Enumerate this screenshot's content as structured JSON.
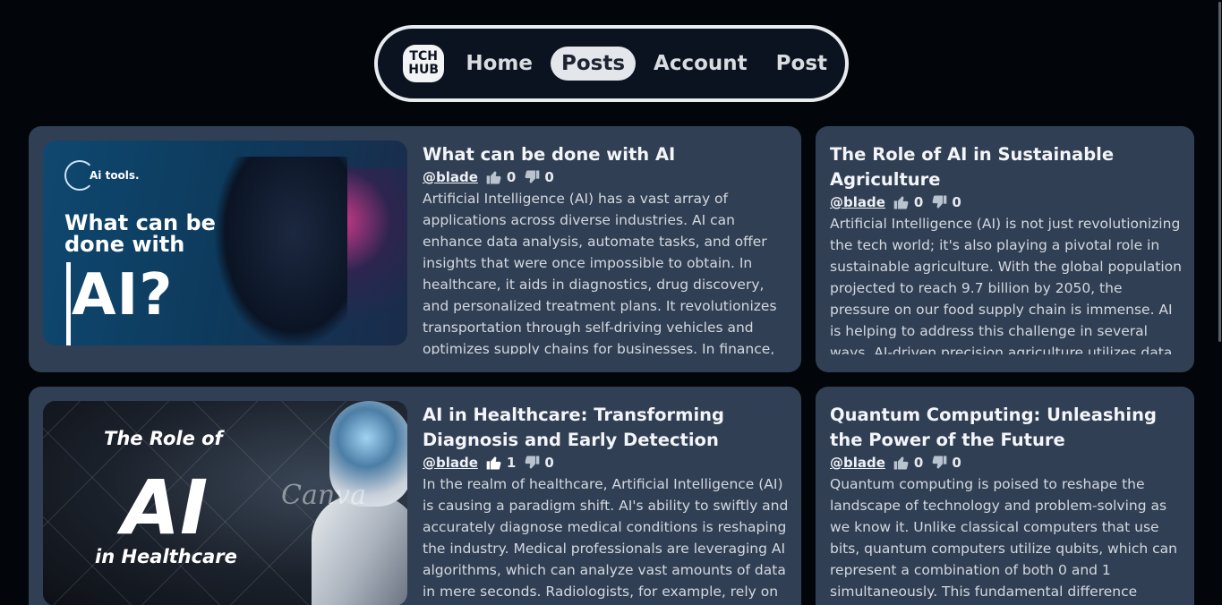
{
  "nav": {
    "logo_line1": "TCH",
    "logo_line2": "HUB",
    "links": [
      "Home",
      "Posts",
      "Account",
      "Post"
    ],
    "active": "Posts"
  },
  "posts": [
    {
      "title": "What can be done with AI",
      "author": "@blade",
      "likes": "0",
      "dislikes": "0",
      "excerpt": "Artificial Intelligence (AI) has a vast array of applications across diverse industries. AI can enhance data analysis, automate tasks, and offer insights that were once impossible to obtain. In healthcare, it aids in diagnostics, drug discovery, and personalized treatment plans. It revolutionizes transportation through self-driving vehicles and optimizes supply chains for businesses. In finance, AI detects",
      "image": {
        "brand": "Ai tools.",
        "heading_line1": "What can be",
        "heading_line2": "done with",
        "big": "AI?"
      }
    },
    {
      "title": "The Role of AI in Sustainable Agriculture",
      "author": "@blade",
      "likes": "0",
      "dislikes": "0",
      "excerpt": "Artificial Intelligence (AI) is not just revolutionizing the tech world; it's also playing a pivotal role in sustainable agriculture. With the global population projected to reach 9.7 billion by 2050, the pressure on our food supply chain is immense. AI is helping to address this challenge in several ways. AI-driven precision agriculture utilizes data from various"
    },
    {
      "title": "AI in Healthcare: Transforming Diagnosis and Early Detection",
      "author": "@blade",
      "likes": "1",
      "dislikes": "0",
      "excerpt": "In the realm of healthcare, Artificial Intelligence (AI) is causing a paradigm shift. AI's ability to swiftly and accurately diagnose medical conditions is reshaping the industry. Medical professionals are leveraging AI algorithms, which can analyze vast amounts of data in mere seconds. Radiologists, for example, rely on AI to",
      "image": {
        "line1": "The Role of",
        "big": "AI",
        "line2": "in Healthcare",
        "watermark": "Canva"
      }
    },
    {
      "title": "Quantum Computing: Unleashing the Power of the Future",
      "author": "@blade",
      "likes": "0",
      "dislikes": "0",
      "excerpt": "Quantum computing is poised to reshape the landscape of technology and problem-solving as we know it. Unlike classical computers that use bits, quantum computers utilize qubits, which can represent a combination of both 0 and 1 simultaneously. This fundamental difference allows"
    }
  ]
}
